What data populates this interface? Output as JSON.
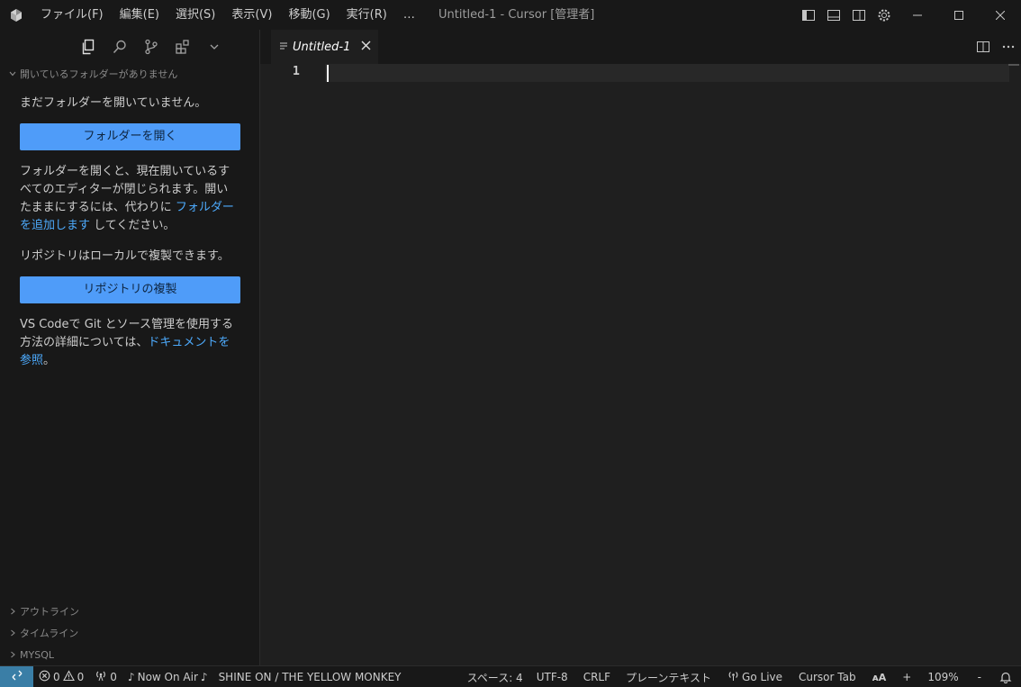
{
  "titlebar": {
    "menu": [
      "ファイル(F)",
      "編集(E)",
      "選択(S)",
      "表示(V)",
      "移動(G)",
      "実行(R)",
      "…"
    ],
    "window_title": "Untitled-1 - Cursor [管理者]"
  },
  "sidebar": {
    "no_folder_header": "開いているフォルダーがありません",
    "welcome_line1": "まだフォルダーを開いていません。",
    "open_folder_button": "フォルダーを開く",
    "para1_before": "フォルダーを開くと、現在開いているすべてのエディターが閉じられます。開いたままにするには、代わりに ",
    "para1_link": "フォルダーを追加します",
    "para1_after": " してください。",
    "clone_text": "リポジトリはローカルで複製できます。",
    "clone_button": "リポジトリの複製",
    "para2_before": "VS Codeで Git とソース管理を使用する方法の詳細については、",
    "para2_link": "ドキュメントを参照",
    "para2_after": "。",
    "bottom_sections": [
      "アウトライン",
      "タイムライン",
      "MYSQL"
    ]
  },
  "editor": {
    "tab_label": "Untitled-1",
    "line_number": "1"
  },
  "statusbar": {
    "errors": "0",
    "warnings": "0",
    "ports": "0",
    "now_on_air": "Now On Air",
    "song": "SHINE ON / THE YELLOW MONKEY",
    "spaces": "スペース: 4",
    "encoding": "UTF-8",
    "eol": "CRLF",
    "language": "プレーンテキスト",
    "go_live": "Go Live",
    "cursor_tab": "Cursor Tab",
    "zoom_plus": "+",
    "zoom": "109%",
    "zoom_minus": "-"
  },
  "colors": {
    "accent_button": "#4f9cf9",
    "link": "#4daafc",
    "remote": "#3a7ea6"
  }
}
